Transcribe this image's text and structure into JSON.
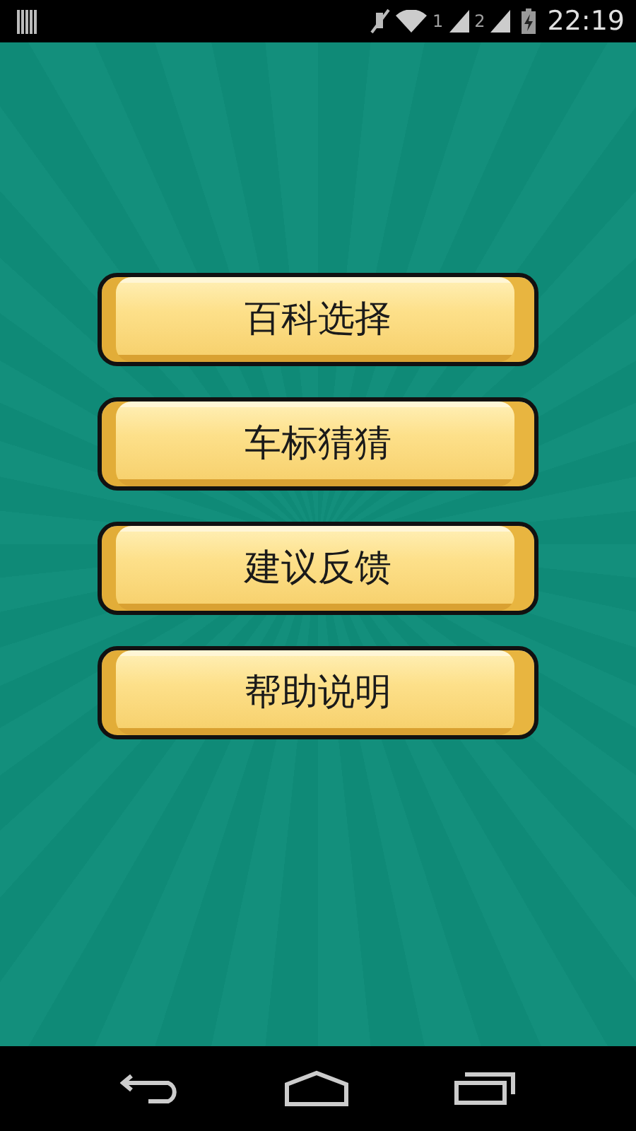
{
  "status_bar": {
    "sim_1": "1",
    "sim_2": "2",
    "time": "22:19"
  },
  "menu": [
    {
      "label": "百科选择"
    },
    {
      "label": "车标猜猜"
    },
    {
      "label": "建议反馈"
    },
    {
      "label": "帮助说明"
    }
  ]
}
